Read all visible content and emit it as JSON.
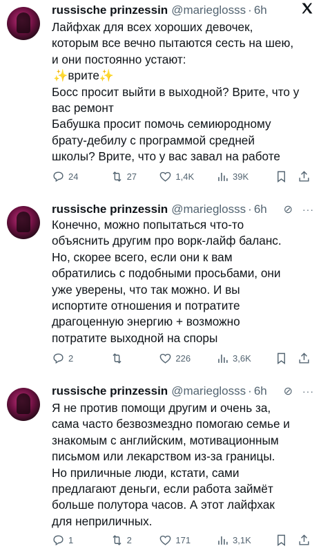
{
  "tweets": [
    {
      "name": "russische prinzessin",
      "handle": "@marieglosss",
      "time": "6h",
      "lines": [
        "Лайфхак для всех хороших девочек,",
        "которым все вечно пытаются сесть на шею,",
        "и они постоянно устают:",
        "✨врите✨",
        "Босс просит выйти в выходной? Врите, что у",
        "вас ремонт",
        "Бабушка просит помочь семиюродному",
        "брату-дебилу с программой средней",
        "школы? Врите, что у вас завал на работе"
      ],
      "replies": "24",
      "retweets": "27",
      "likes": "1,4K",
      "views": "39K"
    },
    {
      "name": "russische prinzessin",
      "handle": "@marieglosss",
      "time": "6h",
      "lines": [
        "Конечно, можно попытаться что-то",
        "объяснить другим про ворк-лайф баланс.",
        "Но, скорее всего, если они к вам",
        "обратились с подобными просьбами, они",
        "уже уверены, что так можно. И вы",
        "испортите отношения и потратите",
        "драгоценную энергию + возможно",
        "потратите выходной на споры"
      ],
      "replies": "2",
      "retweets": "",
      "likes": "226",
      "views": "3,6K"
    },
    {
      "name": "russische prinzessin",
      "handle": "@marieglosss",
      "time": "6h",
      "lines": [
        "Я не против помощи другим и очень за,",
        "сама часто безвозмездно помогаю семье и",
        "знакомым с английским, мотивационным",
        "письмом или лекарством из-за границы.",
        "Но приличные люди, кстати, сами",
        "предлагают деньги, если работа займёт",
        "больше полутора часов. А этот лайфхак",
        "для неприличных."
      ],
      "replies": "1",
      "retweets": "2",
      "likes": "171",
      "views": "3,1K"
    }
  ],
  "icons": {
    "x_logo": "𝕏",
    "mute": "⊘",
    "more": "···"
  }
}
